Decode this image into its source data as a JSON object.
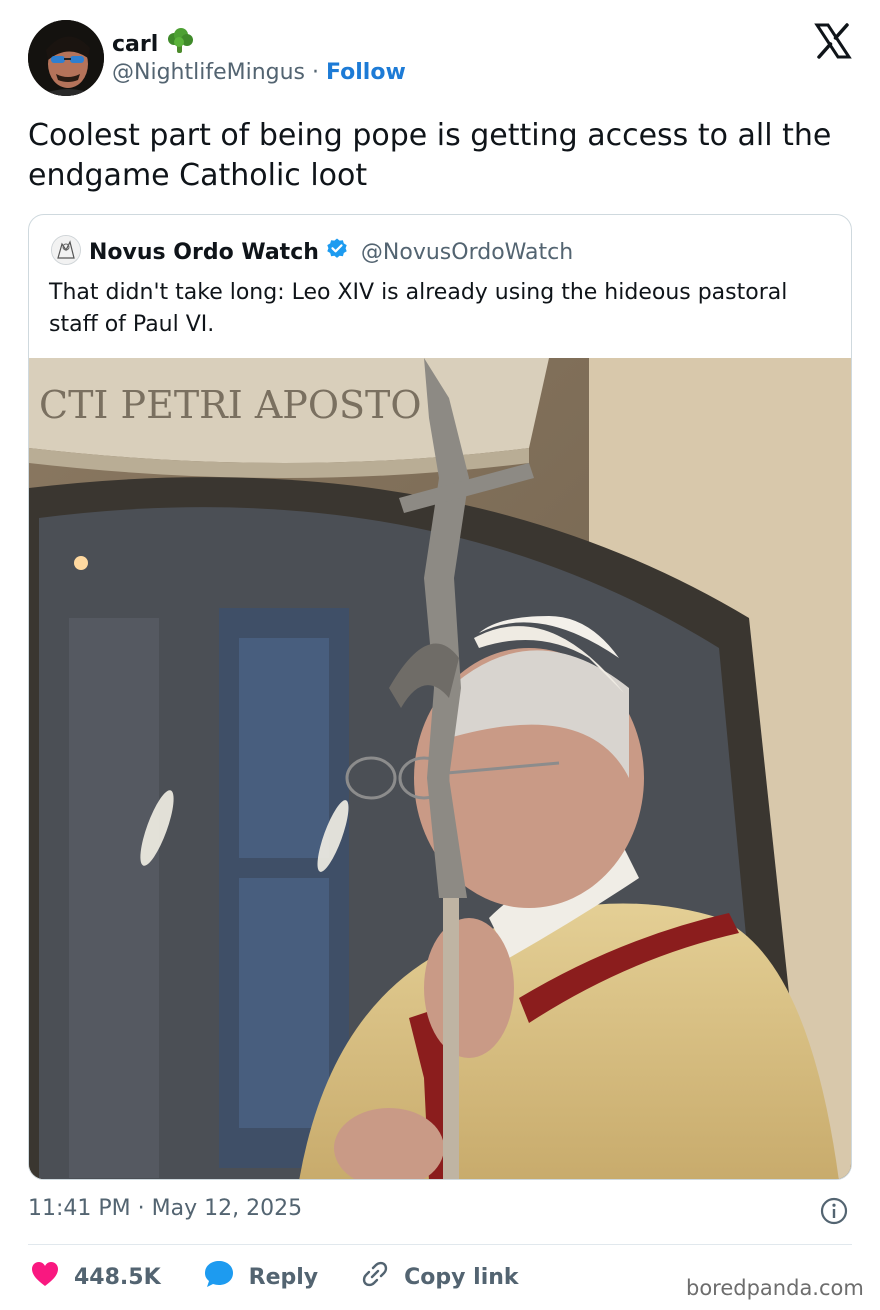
{
  "author": {
    "name": "carl",
    "name_emoji_icon": "broccoli-icon",
    "handle": "@NightlifeMingus",
    "separator": "·",
    "follow_label": "Follow"
  },
  "platform_icon": "x-logo-icon",
  "tweet": {
    "text": "Coolest part of being pope is getting access to all the endgame Catholic loot"
  },
  "quote": {
    "name": "Novus Ordo Watch",
    "verified_icon": "verified-badge-icon",
    "handle": "@NovusOrdoWatch",
    "text": "That didn't take long: Leo XIV is already using the hideous pastoral staff of Paul VI.",
    "photo_inscription": "CTI PETRI APOSTO"
  },
  "meta": {
    "timestamp": "11:41 PM · May 12, 2025",
    "info_icon": "info-icon"
  },
  "actions": {
    "like_count": "448.5K",
    "reply_label": "Reply",
    "copy_label": "Copy link"
  },
  "watermark": "boredpanda.com",
  "colors": {
    "accent": "#1d7bd6",
    "like": "#f91880",
    "reply": "#1d9bf0",
    "muted": "#536471",
    "border": "#cfd9de"
  }
}
